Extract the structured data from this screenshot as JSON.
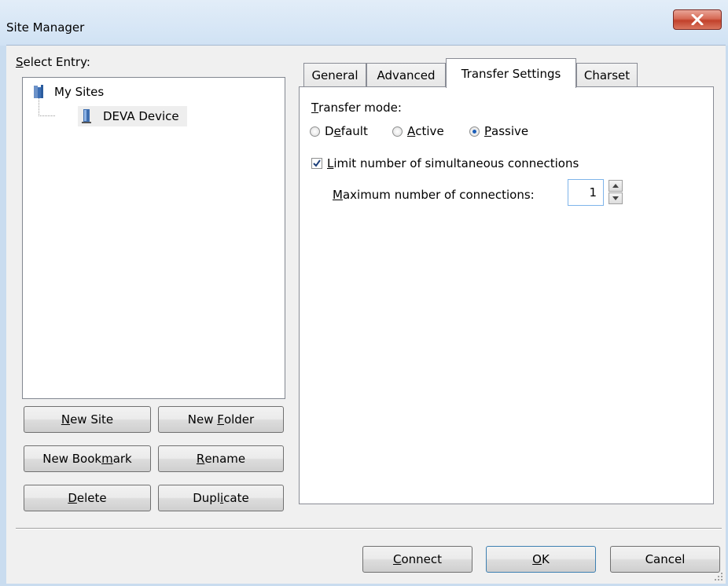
{
  "window": {
    "title": "Site Manager",
    "close_icon": "close-icon"
  },
  "entry_label": {
    "underline": "S",
    "rest": "elect Entry:"
  },
  "tree": {
    "root": {
      "label": "My Sites",
      "icon": "folder-icon"
    },
    "child": {
      "label": "DEVA Device",
      "icon": "server-icon",
      "selected": true
    }
  },
  "buttons": {
    "new_site": {
      "u": "N",
      "rest": "ew Site"
    },
    "new_folder": {
      "pre": "New ",
      "u": "F",
      "rest": "older"
    },
    "new_bookmark": {
      "pre": "New Book",
      "u": "m",
      "rest": "ark"
    },
    "rename": {
      "u": "R",
      "rest": "ename"
    },
    "delete": {
      "u": "D",
      "rest": "elete"
    },
    "duplicate": {
      "pre": "Dupl",
      "u": "i",
      "rest": "cate"
    }
  },
  "tabs": [
    {
      "label": "General"
    },
    {
      "label": "Advanced"
    },
    {
      "label": "Transfer Settings",
      "active": true
    },
    {
      "label": "Charset"
    }
  ],
  "transfer": {
    "mode_label": {
      "u": "T",
      "rest": "ransfer mode:"
    },
    "modes": [
      {
        "pre": "D",
        "u": "e",
        "rest": "fault",
        "checked": false
      },
      {
        "pre": "",
        "u": "A",
        "rest": "ctive",
        "checked": false
      },
      {
        "pre": "",
        "u": "P",
        "rest": "assive",
        "checked": true
      }
    ],
    "limit_label": {
      "u": "L",
      "rest": "imit number of simultaneous connections",
      "checked": true
    },
    "max_label": {
      "u": "M",
      "rest": "aximum number of connections:"
    },
    "max_value": "1"
  },
  "footer": {
    "connect": {
      "u": "C",
      "rest": "onnect"
    },
    "ok": {
      "u": "O",
      "rest": "K"
    },
    "cancel": "Cancel"
  }
}
